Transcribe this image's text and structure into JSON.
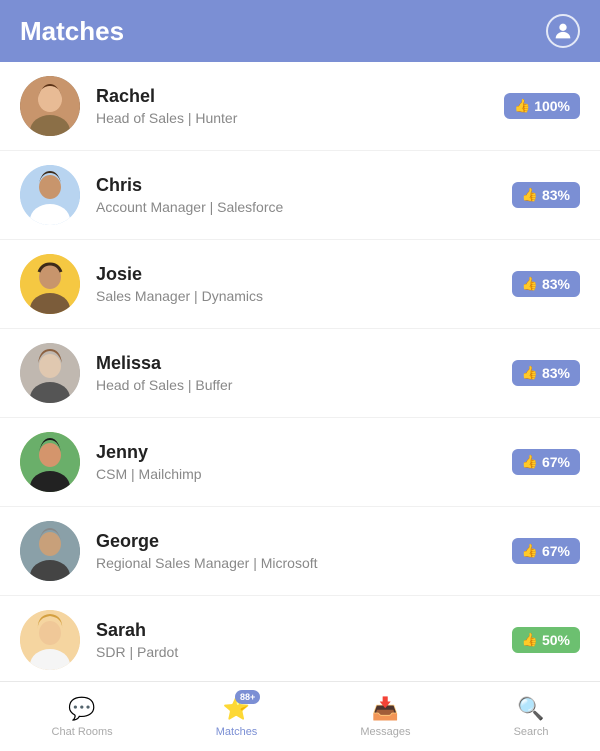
{
  "header": {
    "title": "Matches",
    "profile_icon": "person-icon"
  },
  "matches": [
    {
      "id": "rachel",
      "name": "Rachel",
      "role": "Head of Sales | Hunter",
      "score": "100%",
      "score_color": "blue",
      "avatar_class": "avatar-rachel"
    },
    {
      "id": "chris",
      "name": "Chris",
      "role": "Account Manager | Salesforce",
      "score": "83%",
      "score_color": "blue",
      "avatar_class": "avatar-chris"
    },
    {
      "id": "josie",
      "name": "Josie",
      "role": "Sales Manager | Dynamics",
      "score": "83%",
      "score_color": "blue",
      "avatar_class": "avatar-josie"
    },
    {
      "id": "melissa",
      "name": "Melissa",
      "role": "Head of Sales | Buffer",
      "score": "83%",
      "score_color": "blue",
      "avatar_class": "avatar-melissa"
    },
    {
      "id": "jenny",
      "name": "Jenny",
      "role": "CSM | Mailchimp",
      "score": "67%",
      "score_color": "blue",
      "avatar_class": "avatar-jenny"
    },
    {
      "id": "george",
      "name": "George",
      "role": "Regional Sales Manager | Microsoft",
      "score": "67%",
      "score_color": "blue",
      "avatar_class": "avatar-george"
    },
    {
      "id": "sarah",
      "name": "Sarah",
      "role": "SDR | Pardot",
      "score": "50%",
      "score_color": "green",
      "avatar_class": "avatar-sarah"
    }
  ],
  "nav": {
    "items": [
      {
        "id": "chat-rooms",
        "label": "Chat Rooms",
        "icon": "💬",
        "active": false
      },
      {
        "id": "matches",
        "label": "Matches",
        "icon": "⭐",
        "active": true,
        "badge": "88+"
      },
      {
        "id": "messages",
        "label": "Messages",
        "icon": "📥",
        "active": false
      },
      {
        "id": "search",
        "label": "Search",
        "icon": "🔍",
        "active": false
      }
    ]
  }
}
